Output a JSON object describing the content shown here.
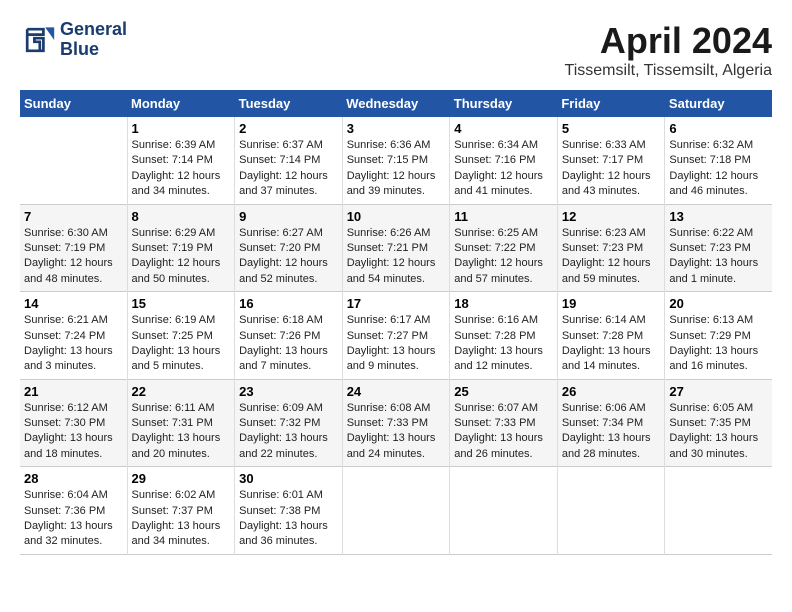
{
  "logo": {
    "name": "GeneralBlue",
    "line1": "General",
    "line2": "Blue"
  },
  "title": "April 2024",
  "subtitle": "Tissemsilt, Tissemsilt, Algeria",
  "days_of_week": [
    "Sunday",
    "Monday",
    "Tuesday",
    "Wednesday",
    "Thursday",
    "Friday",
    "Saturday"
  ],
  "weeks": [
    [
      {
        "day": "",
        "info": ""
      },
      {
        "day": "1",
        "info": "Sunrise: 6:39 AM\nSunset: 7:14 PM\nDaylight: 12 hours\nand 34 minutes."
      },
      {
        "day": "2",
        "info": "Sunrise: 6:37 AM\nSunset: 7:14 PM\nDaylight: 12 hours\nand 37 minutes."
      },
      {
        "day": "3",
        "info": "Sunrise: 6:36 AM\nSunset: 7:15 PM\nDaylight: 12 hours\nand 39 minutes."
      },
      {
        "day": "4",
        "info": "Sunrise: 6:34 AM\nSunset: 7:16 PM\nDaylight: 12 hours\nand 41 minutes."
      },
      {
        "day": "5",
        "info": "Sunrise: 6:33 AM\nSunset: 7:17 PM\nDaylight: 12 hours\nand 43 minutes."
      },
      {
        "day": "6",
        "info": "Sunrise: 6:32 AM\nSunset: 7:18 PM\nDaylight: 12 hours\nand 46 minutes."
      }
    ],
    [
      {
        "day": "7",
        "info": "Sunrise: 6:30 AM\nSunset: 7:19 PM\nDaylight: 12 hours\nand 48 minutes."
      },
      {
        "day": "8",
        "info": "Sunrise: 6:29 AM\nSunset: 7:19 PM\nDaylight: 12 hours\nand 50 minutes."
      },
      {
        "day": "9",
        "info": "Sunrise: 6:27 AM\nSunset: 7:20 PM\nDaylight: 12 hours\nand 52 minutes."
      },
      {
        "day": "10",
        "info": "Sunrise: 6:26 AM\nSunset: 7:21 PM\nDaylight: 12 hours\nand 54 minutes."
      },
      {
        "day": "11",
        "info": "Sunrise: 6:25 AM\nSunset: 7:22 PM\nDaylight: 12 hours\nand 57 minutes."
      },
      {
        "day": "12",
        "info": "Sunrise: 6:23 AM\nSunset: 7:23 PM\nDaylight: 12 hours\nand 59 minutes."
      },
      {
        "day": "13",
        "info": "Sunrise: 6:22 AM\nSunset: 7:23 PM\nDaylight: 13 hours\nand 1 minute."
      }
    ],
    [
      {
        "day": "14",
        "info": "Sunrise: 6:21 AM\nSunset: 7:24 PM\nDaylight: 13 hours\nand 3 minutes."
      },
      {
        "day": "15",
        "info": "Sunrise: 6:19 AM\nSunset: 7:25 PM\nDaylight: 13 hours\nand 5 minutes."
      },
      {
        "day": "16",
        "info": "Sunrise: 6:18 AM\nSunset: 7:26 PM\nDaylight: 13 hours\nand 7 minutes."
      },
      {
        "day": "17",
        "info": "Sunrise: 6:17 AM\nSunset: 7:27 PM\nDaylight: 13 hours\nand 9 minutes."
      },
      {
        "day": "18",
        "info": "Sunrise: 6:16 AM\nSunset: 7:28 PM\nDaylight: 13 hours\nand 12 minutes."
      },
      {
        "day": "19",
        "info": "Sunrise: 6:14 AM\nSunset: 7:28 PM\nDaylight: 13 hours\nand 14 minutes."
      },
      {
        "day": "20",
        "info": "Sunrise: 6:13 AM\nSunset: 7:29 PM\nDaylight: 13 hours\nand 16 minutes."
      }
    ],
    [
      {
        "day": "21",
        "info": "Sunrise: 6:12 AM\nSunset: 7:30 PM\nDaylight: 13 hours\nand 18 minutes."
      },
      {
        "day": "22",
        "info": "Sunrise: 6:11 AM\nSunset: 7:31 PM\nDaylight: 13 hours\nand 20 minutes."
      },
      {
        "day": "23",
        "info": "Sunrise: 6:09 AM\nSunset: 7:32 PM\nDaylight: 13 hours\nand 22 minutes."
      },
      {
        "day": "24",
        "info": "Sunrise: 6:08 AM\nSunset: 7:33 PM\nDaylight: 13 hours\nand 24 minutes."
      },
      {
        "day": "25",
        "info": "Sunrise: 6:07 AM\nSunset: 7:33 PM\nDaylight: 13 hours\nand 26 minutes."
      },
      {
        "day": "26",
        "info": "Sunrise: 6:06 AM\nSunset: 7:34 PM\nDaylight: 13 hours\nand 28 minutes."
      },
      {
        "day": "27",
        "info": "Sunrise: 6:05 AM\nSunset: 7:35 PM\nDaylight: 13 hours\nand 30 minutes."
      }
    ],
    [
      {
        "day": "28",
        "info": "Sunrise: 6:04 AM\nSunset: 7:36 PM\nDaylight: 13 hours\nand 32 minutes."
      },
      {
        "day": "29",
        "info": "Sunrise: 6:02 AM\nSunset: 7:37 PM\nDaylight: 13 hours\nand 34 minutes."
      },
      {
        "day": "30",
        "info": "Sunrise: 6:01 AM\nSunset: 7:38 PM\nDaylight: 13 hours\nand 36 minutes."
      },
      {
        "day": "",
        "info": ""
      },
      {
        "day": "",
        "info": ""
      },
      {
        "day": "",
        "info": ""
      },
      {
        "day": "",
        "info": ""
      }
    ]
  ]
}
